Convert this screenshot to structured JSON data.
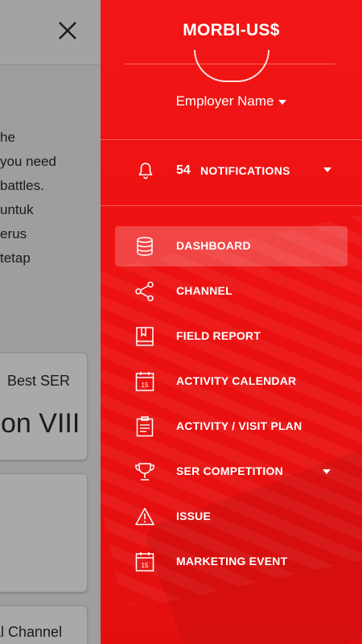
{
  "background": {
    "text_lines": [
      "he",
      "you need",
      "battles.",
      "untuk",
      "erus",
      "tetap"
    ],
    "card1": {
      "title": "Best SER",
      "big": "on VIII"
    },
    "card3": {
      "title": "al Channel"
    }
  },
  "drawer": {
    "app_title": "MORBI-US$",
    "employer_name": "Employer Name",
    "notifications": {
      "count": "54",
      "label": "NOTIFICATIONS",
      "icon": "bell-icon"
    },
    "menu": [
      {
        "label": "DASHBOARD",
        "icon": "database-icon",
        "active": true
      },
      {
        "label": "CHANNEL",
        "icon": "share-icon"
      },
      {
        "label": "FIELD REPORT",
        "icon": "book-icon"
      },
      {
        "label": "ACTIVITY CALENDAR",
        "icon": "calendar-icon"
      },
      {
        "label": "ACTIVITY / VISIT PLAN",
        "icon": "clipboard-icon"
      },
      {
        "label": "SER COMPETITION",
        "icon": "trophy-icon",
        "expandable": true
      },
      {
        "label": "ISSUE",
        "icon": "warning-icon"
      },
      {
        "label": "MARKETING EVENT",
        "icon": "calendar-icon"
      }
    ],
    "calendar_icon_day": "15",
    "accent_color": "#ee1111"
  }
}
